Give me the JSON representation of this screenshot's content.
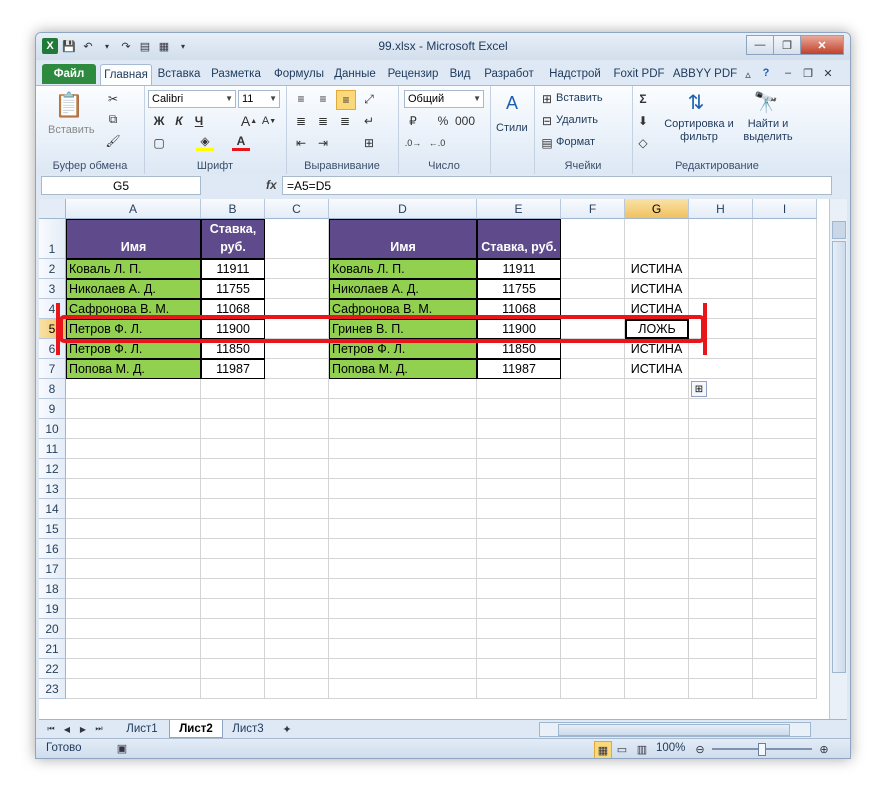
{
  "window": {
    "title": "99.xlsx - Microsoft Excel",
    "min_label": "—",
    "max_label": "❐",
    "close_label": "✕"
  },
  "ribbon_tabs": [
    "Файл",
    "Главная",
    "Вставка",
    "Разметка",
    "Формулы",
    "Данные",
    "Рецензир",
    "Вид",
    "Разработ",
    "Надстрой",
    "Foxit PDF",
    "ABBYY PDF"
  ],
  "ribbon": {
    "clipboard": {
      "paste": "Вставить",
      "label": "Буфер обмена"
    },
    "font": {
      "name": "Calibri",
      "size": "11",
      "bold": "Ж",
      "italic": "К",
      "underline": "Ч",
      "label": "Шрифт"
    },
    "alignment": {
      "label": "Выравнивание"
    },
    "number": {
      "format": "Общий",
      "label": "Число"
    },
    "styles": {
      "label": "Стили"
    },
    "cells": {
      "insert": "Вставить",
      "delete": "Удалить",
      "format": "Формат",
      "label": "Ячейки"
    },
    "editing": {
      "sort": "Сортировка и фильтр",
      "find": "Найти и выделить",
      "label": "Редактирование"
    }
  },
  "formula_bar": {
    "name_box": "G5",
    "fx": "fx",
    "formula": "=A5=D5"
  },
  "columns": [
    "A",
    "B",
    "C",
    "D",
    "E",
    "F",
    "G",
    "H",
    "I"
  ],
  "rows": [
    "1",
    "2",
    "3",
    "4",
    "5",
    "6",
    "7",
    "8",
    "9",
    "10",
    "11",
    "12",
    "13",
    "14",
    "15",
    "16",
    "17",
    "18",
    "19",
    "20",
    "21",
    "22",
    "23"
  ],
  "selected": {
    "column": "G",
    "row": "5"
  },
  "table1": {
    "header_name": "Имя",
    "header_rate": "Ставка, руб.",
    "rows": [
      {
        "name": "Коваль Л. П.",
        "rate": "11911"
      },
      {
        "name": "Николаев А. Д.",
        "rate": "11755"
      },
      {
        "name": "Сафронова В. М.",
        "rate": "11068"
      },
      {
        "name": "Петров Ф. Л.",
        "rate": "11900"
      },
      {
        "name": "Петров Ф. Л.",
        "rate": "11850"
      },
      {
        "name": "Попова М. Д.",
        "rate": "11987"
      }
    ]
  },
  "table2": {
    "header_name": "Имя",
    "header_rate": "Ставка, руб.",
    "rows": [
      {
        "name": "Коваль Л. П.",
        "rate": "11911"
      },
      {
        "name": "Николаев А. Д.",
        "rate": "11755"
      },
      {
        "name": "Сафронова В. М.",
        "rate": "11068"
      },
      {
        "name": "Гринев В. П.",
        "rate": "11900"
      },
      {
        "name": "Петров Ф. Л.",
        "rate": "11850"
      },
      {
        "name": "Попова М. Д.",
        "rate": "11987"
      }
    ]
  },
  "results": [
    "ИСТИНА",
    "ИСТИНА",
    "ИСТИНА",
    "ЛОЖЬ",
    "ИСТИНА",
    "ИСТИНА"
  ],
  "sheets": [
    "Лист1",
    "Лист2",
    "Лист3"
  ],
  "active_sheet": "Лист2",
  "status": {
    "ready": "Готово",
    "zoom": "100%"
  }
}
